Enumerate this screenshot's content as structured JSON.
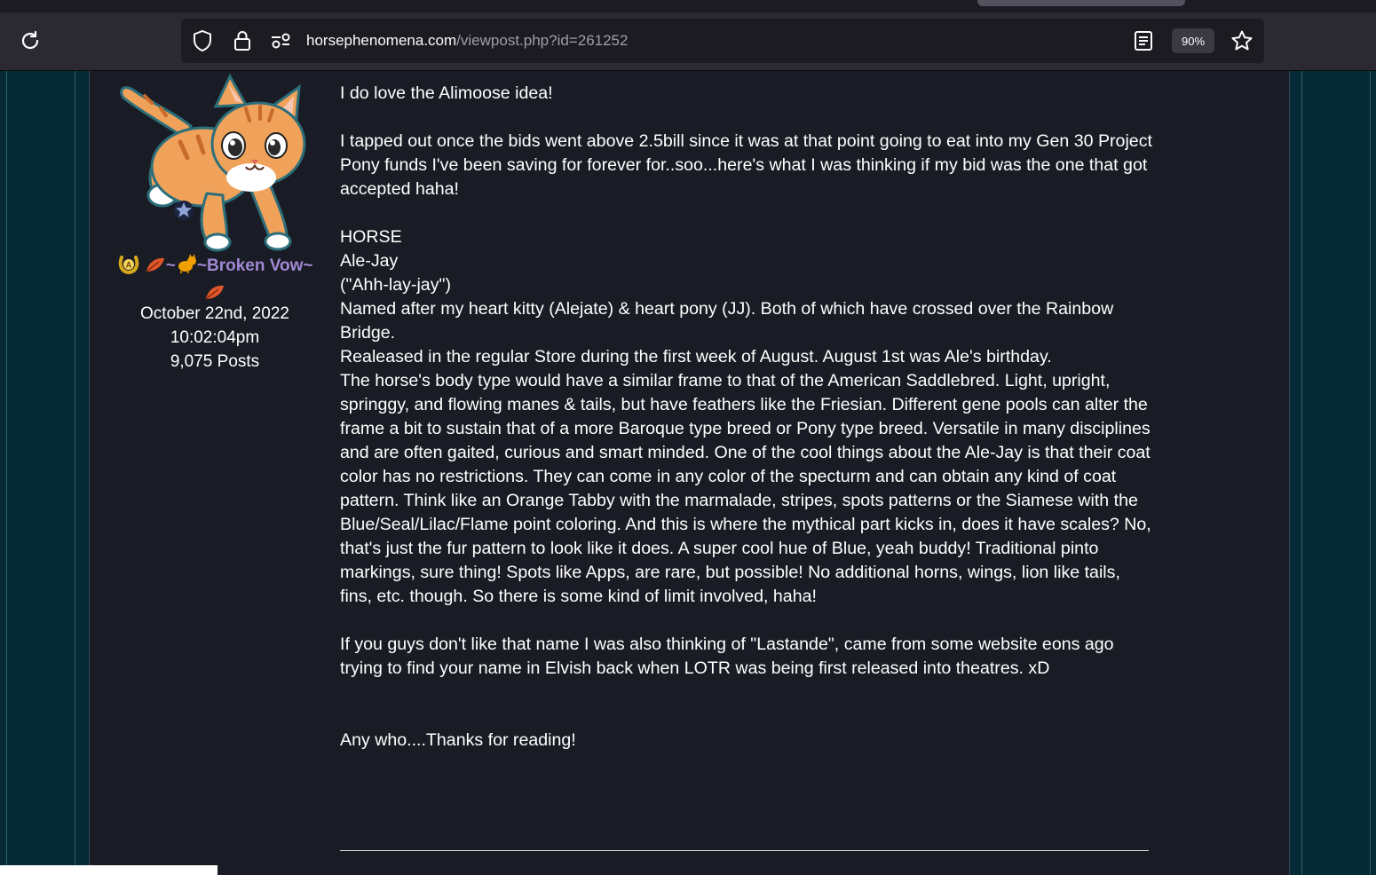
{
  "browser": {
    "url_host": "horsephenomena.com",
    "url_path": "/viewpost.php?id=261252",
    "zoom": "90%"
  },
  "colors": {
    "page_bg": "#052a35",
    "card_bg": "#191c24",
    "username": "#a089d4",
    "toolbar_bg": "#2b2a33"
  },
  "user": {
    "name_line1": "~Broken Vow~",
    "date": "October 22nd, 2022",
    "time": "10:02:04pm",
    "posts": "9,075 Posts",
    "badges": [
      "horseshoe-badge-icon",
      "leaf-icon",
      "cat-icon",
      "leaf-icon"
    ]
  },
  "post": {
    "p1": "I do love the Alimoose idea!",
    "p2": "I tapped out once the bids went above 2.5bill since it was at that point going to eat into my Gen 30 Project Pony funds I've been saving for forever for..soo...here's what I was thinking if my bid was the one that got accepted haha!",
    "l1": "HORSE",
    "l2": "Ale-Jay",
    "l3": "(\"Ahh-lay-jay\")",
    "l4": "Named after my heart kitty (Alejate) & heart pony (JJ). Both of which have crossed over the Rainbow Bridge.",
    "l5": "Realeased in the regular Store during the first week of August. August 1st was Ale's birthday.",
    "l6": "The horse's body type would have a similar frame to that of the American Saddlebred. Light, upright, springgy, and flowing manes & tails, but have feathers like the Friesian. Different gene pools can alter the frame a bit to sustain that of a more Baroque type breed or Pony type breed. Versatile in many disciplines and are often gaited, curious and smart minded. One of the cool things about the Ale-Jay is that their coat color has no restrictions. They can come in any color of the specturm and can obtain any kind of coat pattern. Think like an Orange Tabby with the marmalade, stripes, spots patterns or the Siamese with the Blue/Seal/Lilac/Flame point coloring. And this is where the mythical part kicks in, does it have scales? No, that's just the fur pattern to look like it does. A super cool hue of Blue, yeah buddy! Traditional pinto markings, sure thing! Spots like Apps, are rare, but possible! No additional horns, wings, lion like tails, fins, etc. though. So there is some kind of limit involved, haha!",
    "p3": "If you guys don't like that name I was also thinking of \"Lastande\", came from some website eons ago trying to find your name in Elvish back when LOTR was being first released into theatres. xD",
    "p4": "Any who....Thanks for reading!"
  }
}
